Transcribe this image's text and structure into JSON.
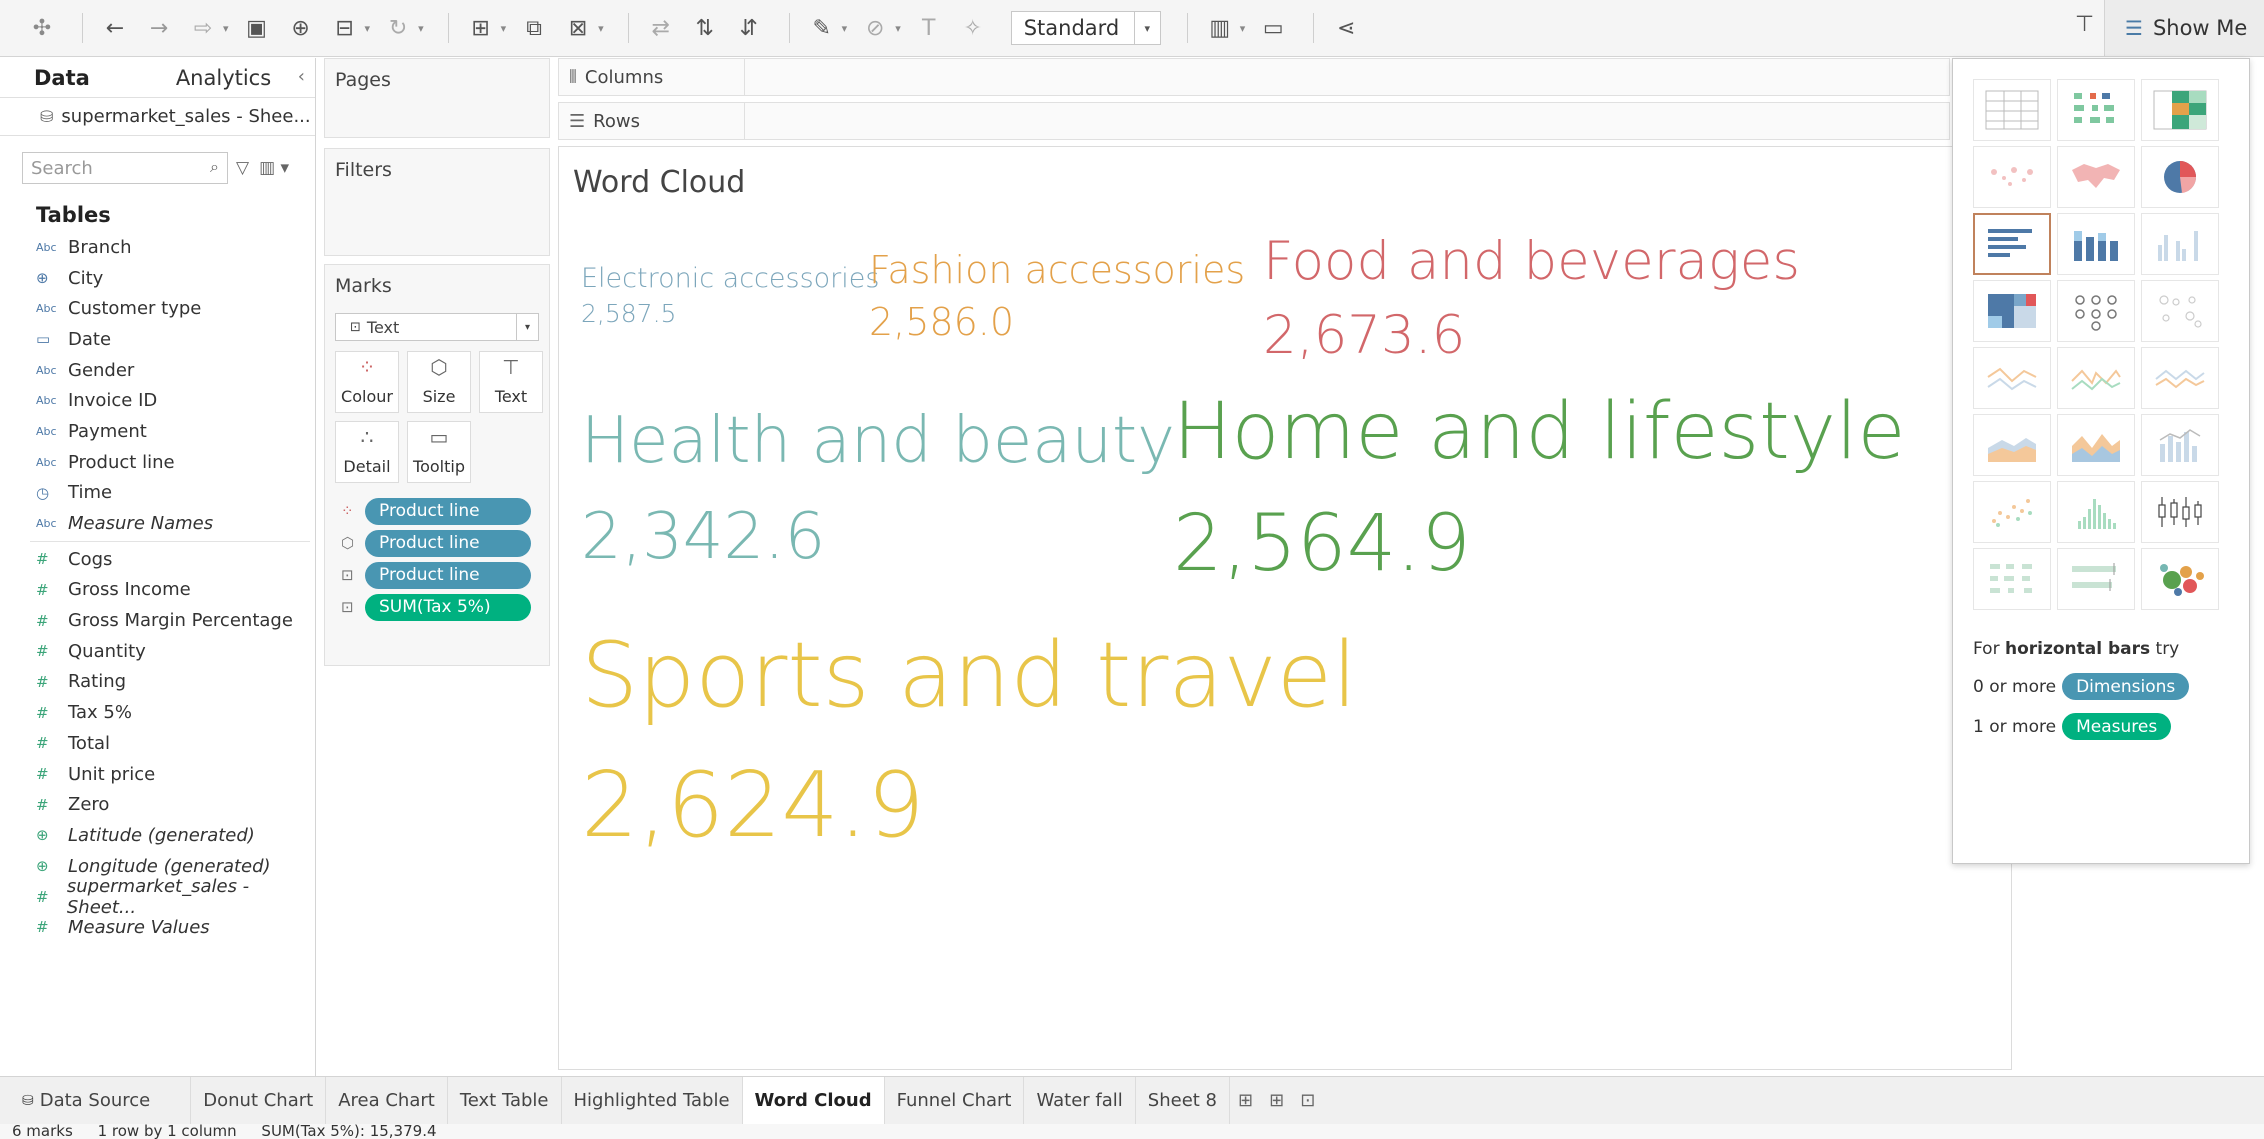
{
  "toolbar": {
    "view_mode": "Standard",
    "show_me_label": "Show Me"
  },
  "data_pane": {
    "tab_data": "Data",
    "tab_analytics": "Analytics",
    "datasource": "supermarket_sales - Shee...",
    "search_placeholder": "Search",
    "tables_title": "Tables",
    "dimensions": [
      {
        "type": "Abc",
        "name": "Branch"
      },
      {
        "type": "geo",
        "name": "City"
      },
      {
        "type": "Abc",
        "name": "Customer type"
      },
      {
        "type": "date",
        "name": "Date"
      },
      {
        "type": "Abc",
        "name": "Gender"
      },
      {
        "type": "Abc",
        "name": "Invoice ID"
      },
      {
        "type": "Abc",
        "name": "Payment"
      },
      {
        "type": "Abc",
        "name": "Product line"
      },
      {
        "type": "time",
        "name": "Time"
      },
      {
        "type": "Abc",
        "name": "Measure Names"
      }
    ],
    "measures": [
      {
        "name": "Cogs"
      },
      {
        "name": "Gross Income"
      },
      {
        "name": "Gross Margin Percentage"
      },
      {
        "name": "Quantity"
      },
      {
        "name": "Rating"
      },
      {
        "name": "Tax 5%"
      },
      {
        "name": "Total"
      },
      {
        "name": "Unit price"
      },
      {
        "name": "Zero"
      },
      {
        "name": "Latitude (generated)"
      },
      {
        "name": "Longitude (generated)"
      },
      {
        "name": "supermarket_sales - Sheet..."
      },
      {
        "name": "Measure Values"
      }
    ]
  },
  "cards": {
    "pages": "Pages",
    "filters": "Filters",
    "marks": "Marks",
    "mark_type": "Text",
    "mark_buttons": [
      "Colour",
      "Size",
      "Text",
      "Detail",
      "Tooltip"
    ],
    "pills": [
      "Product line",
      "Product line",
      "Product line",
      "SUM(Tax 5%)"
    ]
  },
  "shelves": {
    "columns": "Columns",
    "rows": "Rows"
  },
  "viz": {
    "title": "Word Cloud",
    "words": [
      {
        "label": "Electronic accessories",
        "value": "2,587.5",
        "color": "#7ca6bb"
      },
      {
        "label": "Fashion accessories",
        "value": "2,586.0",
        "color": "#e3a14a"
      },
      {
        "label": "Food and beverages",
        "value": "2,673.6",
        "color": "#d2676a"
      },
      {
        "label": "Health and beauty",
        "value": "2,342.6",
        "color": "#7ab8b2"
      },
      {
        "label": "Home and lifestyle",
        "value": "2,564.9",
        "color": "#59a14f"
      },
      {
        "label": "Sports and travel",
        "value": "2,624.9",
        "color": "#e8c549"
      }
    ]
  },
  "show_me": {
    "hint_prefix": "For ",
    "hint_bold": "horizontal bars",
    "hint_suffix": " try",
    "dim_prefix": "0 or more",
    "dim_pill": "Dimensions",
    "mea_prefix": "1 or more",
    "mea_pill": "Measures"
  },
  "sheet_tabs": {
    "data_source": "Data Source",
    "tabs": [
      "Donut Chart",
      "Area Chart",
      "Text Table",
      "Highlighted Table",
      "Word Cloud",
      "Funnel Chart",
      "Water fall",
      "Sheet 8"
    ],
    "active": "Word Cloud"
  },
  "status": {
    "marks": "6 marks",
    "dims": "1 row by 1 column",
    "sum": "SUM(Tax 5%): 15,379.4"
  }
}
